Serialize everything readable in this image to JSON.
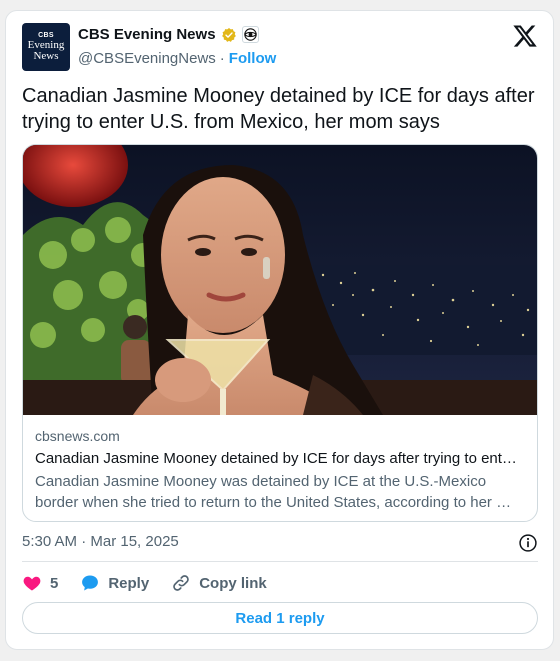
{
  "author": {
    "avatar_text": [
      "CBS",
      "Evening",
      "News"
    ],
    "display_name": "CBS Evening News",
    "handle": "@CBSEveningNews",
    "separator": "·",
    "follow_label": "Follow",
    "verified_icon": "gold-verified-badge-icon",
    "affiliate_icon": "cbs-eye-icon"
  },
  "tweet": {
    "text": "Canadian Jasmine Mooney detained by ICE for days after trying to enter U.S. from Mexico, her mom says"
  },
  "link_card": {
    "domain": "cbsnews.com",
    "title": "Canadian Jasmine Mooney detained by ICE for days after trying to ent…",
    "description": "Canadian Jasmine Mooney was detained by ICE at the U.S.-Mexico border when she tried to return to the United States, according to her …"
  },
  "meta": {
    "timestamp": "5:30 AM · Mar 15, 2025"
  },
  "actions": {
    "like_count": "5",
    "reply_label": "Reply",
    "copy_link_label": "Copy link"
  },
  "read_replies_label": "Read 1 reply",
  "colors": {
    "accent": "#1d9bf0",
    "like": "#f91880",
    "text_secondary": "#536471",
    "verified_gold": "#e2b719"
  }
}
